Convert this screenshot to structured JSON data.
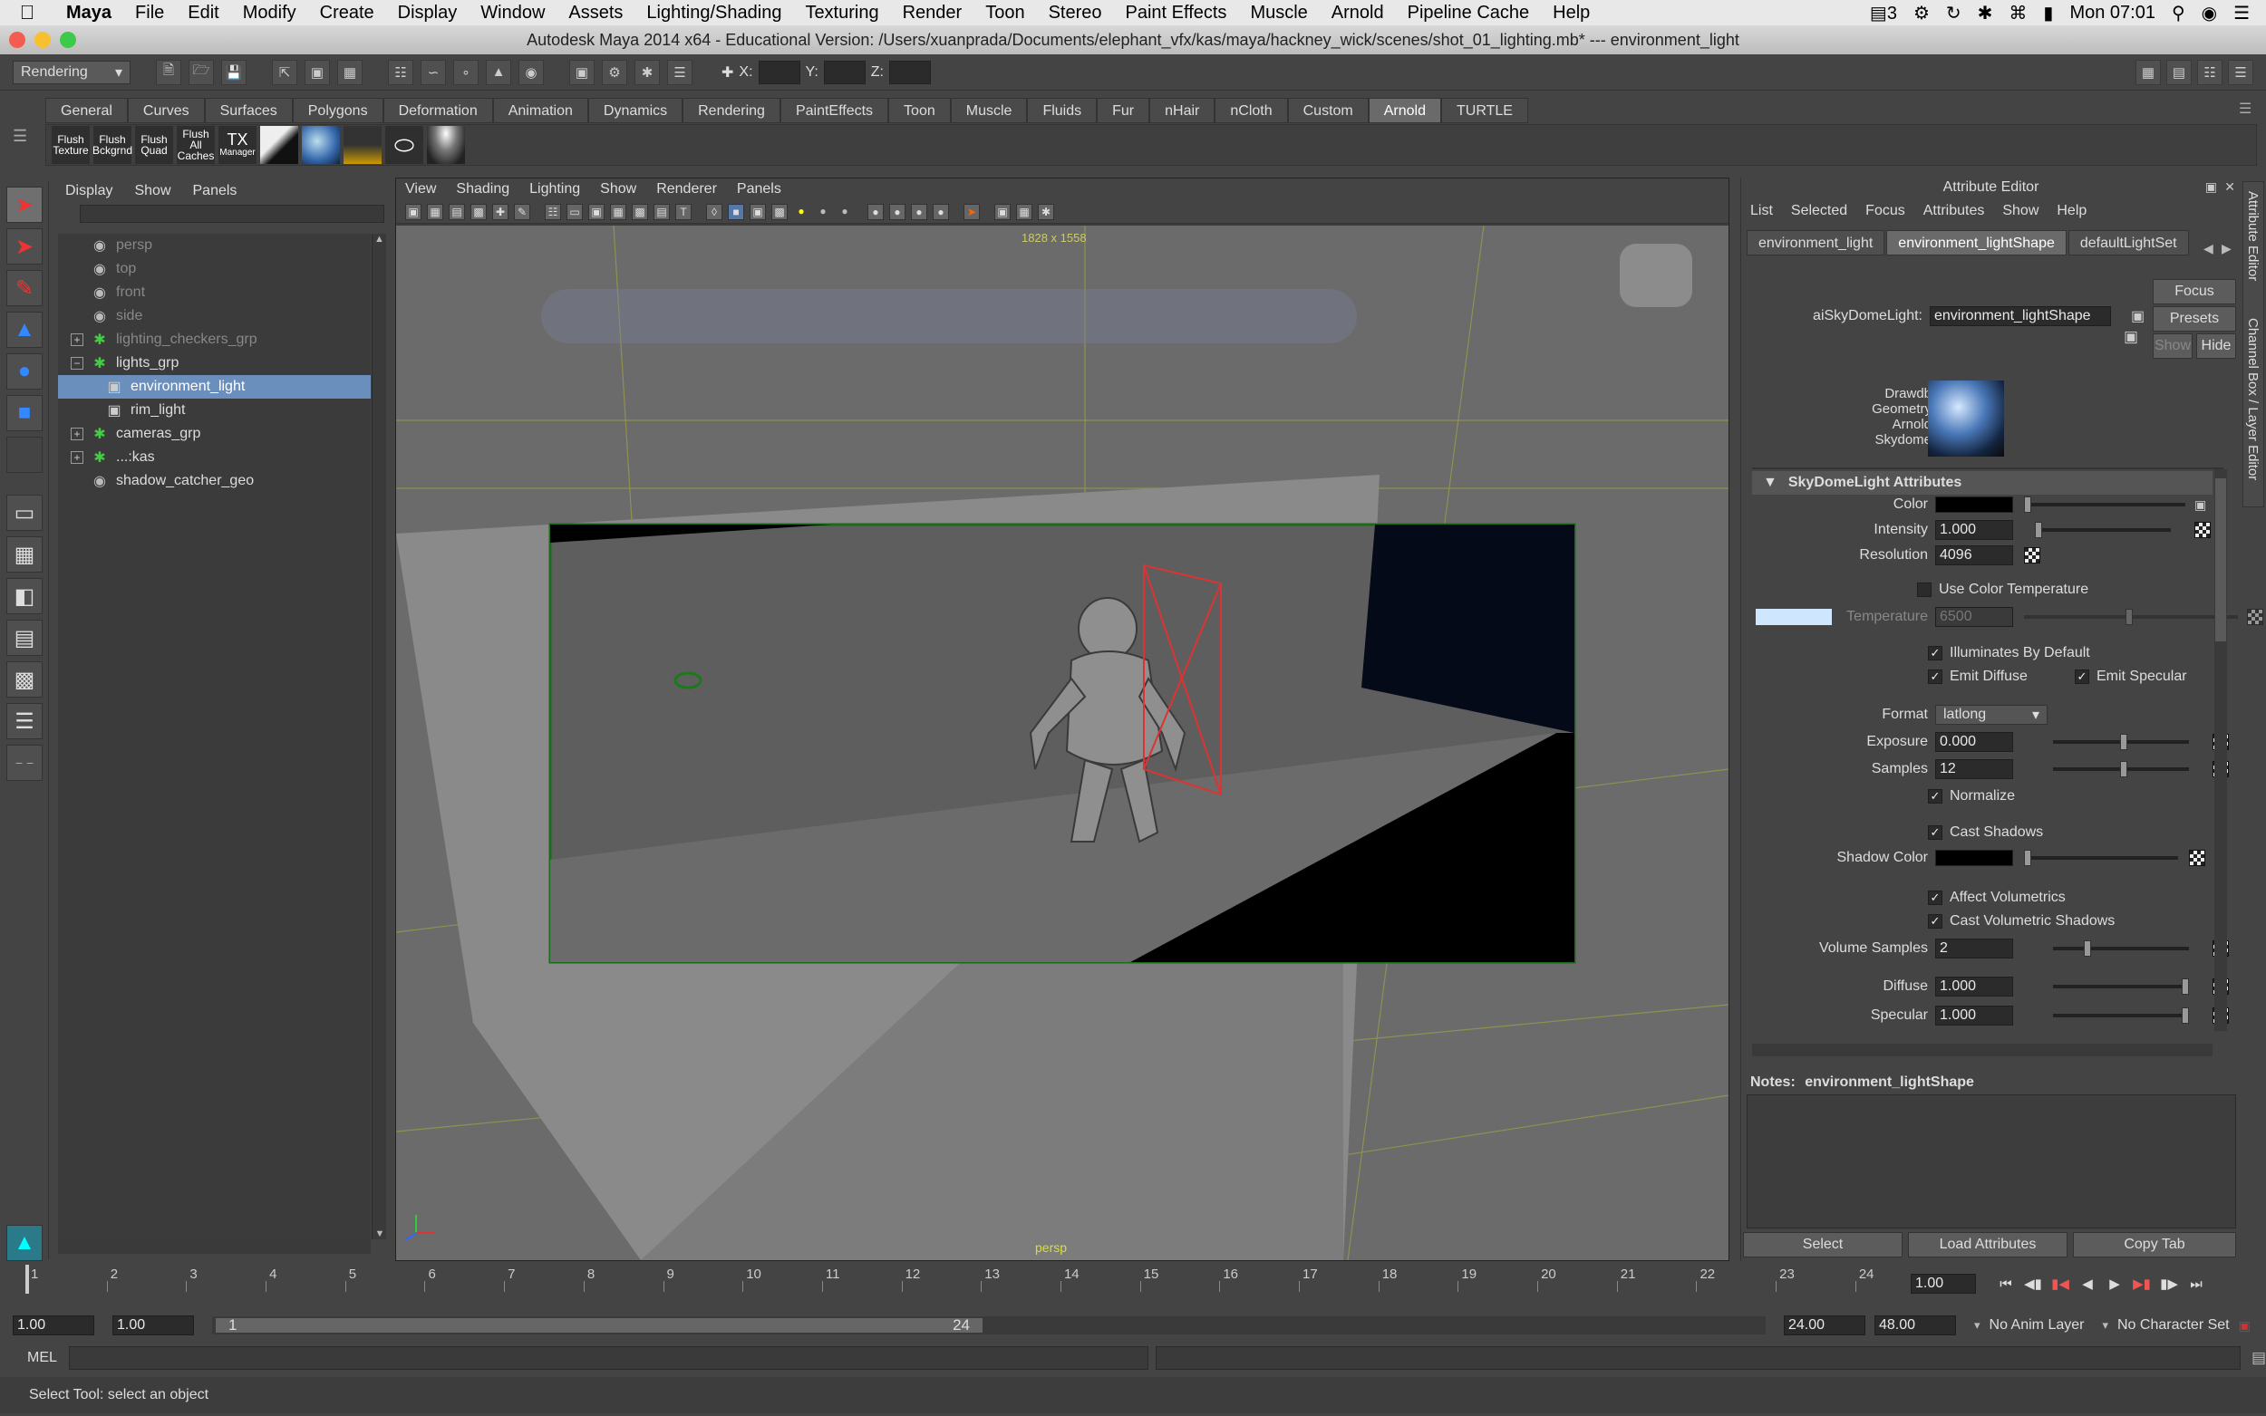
{
  "menubar": {
    "app_name": "Maya",
    "items": [
      "File",
      "Edit",
      "Modify",
      "Create",
      "Display",
      "Window",
      "Assets",
      "Lighting/Shading",
      "Texturing",
      "Render",
      "Toon",
      "Stereo",
      "Paint Effects",
      "Muscle",
      "Arnold",
      "Pipeline Cache",
      "Help"
    ],
    "status_num": "3",
    "clock": "Mon 07:01"
  },
  "window": {
    "title": "Autodesk Maya 2014 x64 - Educational Version: /Users/xuanprada/Documents/elephant_vfx/kas/maya/hackney_wick/scenes/shot_01_lighting.mb*   ---   environment_light"
  },
  "statusline": {
    "menuset": "Rendering",
    "x_label": "X:",
    "y_label": "Y:",
    "z_label": "Z:"
  },
  "shelf": {
    "tabs": [
      "General",
      "Curves",
      "Surfaces",
      "Polygons",
      "Deformation",
      "Animation",
      "Dynamics",
      "Rendering",
      "PaintEffects",
      "Toon",
      "Muscle",
      "Fluids",
      "Fur",
      "nHair",
      "nCloth",
      "Custom",
      "Arnold",
      "TURTLE"
    ],
    "active_tab": "Arnold",
    "buttons": [
      {
        "line1": "Flush",
        "line2": "Texture"
      },
      {
        "line1": "Flush",
        "line2": "Bckgrnd"
      },
      {
        "line1": "Flush",
        "line2": "Quad"
      },
      {
        "line1": "Flush",
        "line2": "All Caches"
      },
      {
        "line1": "TX",
        "line2": "Manager"
      }
    ]
  },
  "outliner": {
    "menus": [
      "Display",
      "Show",
      "Panels"
    ],
    "items": [
      {
        "label": "persp",
        "icon": "camera",
        "dim": true,
        "expand": ""
      },
      {
        "label": "top",
        "icon": "camera",
        "dim": true,
        "expand": ""
      },
      {
        "label": "front",
        "icon": "camera",
        "dim": true,
        "expand": ""
      },
      {
        "label": "side",
        "icon": "camera",
        "dim": true,
        "expand": ""
      },
      {
        "label": "lighting_checkers_grp",
        "icon": "group",
        "dim": true,
        "expand": "+"
      },
      {
        "label": "lights_grp",
        "icon": "group",
        "dim": false,
        "expand": "−"
      },
      {
        "label": "environment_light",
        "icon": "light",
        "dim": false,
        "expand": "",
        "selected": true,
        "indent": true
      },
      {
        "label": "rim_light",
        "icon": "light",
        "dim": false,
        "expand": "",
        "indent": true
      },
      {
        "label": "cameras_grp",
        "icon": "group",
        "dim": false,
        "expand": "+"
      },
      {
        "label": "...:kas",
        "icon": "group",
        "dim": false,
        "expand": "+"
      },
      {
        "label": "shadow_catcher_geo",
        "icon": "mesh",
        "dim": false,
        "expand": ""
      }
    ]
  },
  "viewport": {
    "menus": [
      "View",
      "Shading",
      "Lighting",
      "Show",
      "Renderer",
      "Panels"
    ],
    "resolution": "1828 x 1558",
    "camera": "persp"
  },
  "attribute_editor": {
    "title": "Attribute Editor",
    "menus": [
      "List",
      "Selected",
      "Focus",
      "Attributes",
      "Show",
      "Help"
    ],
    "tabs": [
      "environment_light",
      "environment_lightShape",
      "defaultLightSet"
    ],
    "active_tab": "environment_lightShape",
    "node_type_label": "aiSkyDomeLight:",
    "node_name": "environment_lightShape",
    "focus_btn": "Focus",
    "presets_btn": "Presets",
    "show_btn": "Show",
    "hide_btn": "Hide",
    "swatch_lines": [
      "Drawdb",
      "Geometry",
      "Arnold",
      "Skydome"
    ],
    "section_title": "SkyDomeLight Attributes",
    "color_label": "Color",
    "color_value": "#000000",
    "intensity_label": "Intensity",
    "intensity": "1.000",
    "resolution_label": "Resolution",
    "resolution": "4096",
    "use_color_temp_label": "Use Color Temperature",
    "temperature_label": "Temperature",
    "temperature": "6500",
    "illuminates_label": "Illuminates By Default",
    "emit_diffuse_label": "Emit Diffuse",
    "emit_specular_label": "Emit Specular",
    "format_label": "Format",
    "format": "latlong",
    "exposure_label": "Exposure",
    "exposure": "0.000",
    "samples_label": "Samples",
    "samples": "12",
    "normalize_label": "Normalize",
    "cast_shadows_label": "Cast Shadows",
    "shadow_color_label": "Shadow Color",
    "affect_vol_label": "Affect Volumetrics",
    "cast_vol_shadows_label": "Cast Volumetric Shadows",
    "volume_samples_label": "Volume Samples",
    "volume_samples": "2",
    "diffuse_label": "Diffuse",
    "diffuse": "1.000",
    "specular_label": "Specular",
    "specular": "1.000",
    "notes_label": "Notes:",
    "notes_node": "environment_lightShape",
    "select_btn": "Select",
    "load_attr_btn": "Load Attributes",
    "copy_tab_btn": "Copy Tab",
    "side_tabs": [
      "Attribute Editor",
      "Channel Box / Layer Editor"
    ]
  },
  "timeline": {
    "ticks": [
      "1",
      "2",
      "3",
      "4",
      "5",
      "6",
      "7",
      "8",
      "9",
      "10",
      "11",
      "12",
      "13",
      "14",
      "15",
      "16",
      "17",
      "18",
      "19",
      "20",
      "21",
      "22",
      "23",
      "24"
    ],
    "current_time": "1.00",
    "range_start": "1.00",
    "playback_start": "1.00",
    "range_inner_start": "1",
    "range_inner_end": "24",
    "playback_end": "24.00",
    "range_end": "48.00",
    "anim_layer": "No Anim Layer",
    "character_set": "No Character Set"
  },
  "commandline": {
    "label": "MEL"
  },
  "helpline": {
    "text": "Select Tool: select an object"
  }
}
